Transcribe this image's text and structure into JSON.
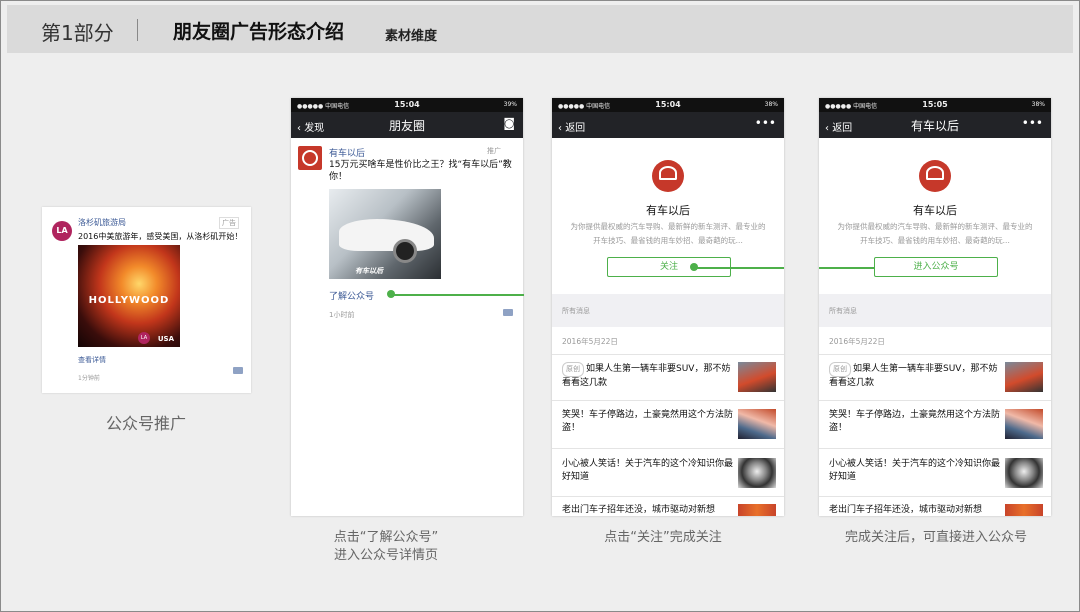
{
  "header": {
    "part": "第1部分",
    "title": "朋友圈广告形态介绍",
    "subtitle": "素材维度"
  },
  "card": {
    "avatar_text": "LA",
    "account": "洛杉矶旅游局",
    "tag": "广告",
    "text": "2016中美旅游年，感受美国，从洛杉矶开始！",
    "image_text": "HOLLYWOOD",
    "image_logo": "LA",
    "image_usa": "USA",
    "detail_link": "查看详情",
    "time": "1分钟前"
  },
  "captions": {
    "c1": "公众号推广",
    "c2_line1": "点击“了解公众号”",
    "c2_line2": "进入公众号详情页",
    "c3": "点击“关注”完成关注",
    "c4": "完成关注后，可直接进入公众号"
  },
  "phone1": {
    "carrier": "●●●●● 中国电信",
    "time": "15:04",
    "battery": "39%",
    "back": "发现",
    "title": "朋友圈",
    "account": "有车以后",
    "tag": "推广",
    "text": "15万元买啥车是性价比之王？找“有车以后”教你！",
    "image_mark": "有车以后",
    "link": "了解公众号",
    "time_ago": "1小时前"
  },
  "phone2": {
    "carrier": "●●●●● 中国电信",
    "time": "15:04",
    "battery": "38%",
    "back": "返回",
    "more": "•••",
    "account": "有车以后",
    "desc": "为你提供最权威的汽车导购、最新鲜的新车测评、最专业的开车技巧、最省钱的用车妙招、最奇葩的玩...",
    "button": "关注"
  },
  "phone3": {
    "carrier": "●●●●● 中国电信",
    "time": "15:05",
    "battery": "38%",
    "back": "返回",
    "title": "有车以后",
    "more": "•••",
    "account": "有车以后",
    "desc": "为你提供最权威的汽车导购、最新鲜的新车测评、最专业的开车技巧、最省钱的用车妙招、最奇葩的玩...",
    "button": "进入公众号"
  },
  "messages": {
    "section": "所有消息",
    "date": "2016年5月22日",
    "original": "原创",
    "m1": "如果人生第一辆车非要SUV，那不妨看看这几款",
    "m2": "笑哭！车子停路边，土豪竟然用这个方法防盗！",
    "m3": "小心被人笑话！关于汽车的这个冷知识你最好知道",
    "m4": "老出门车子招年还没，城市驱动对新想"
  },
  "colors": {
    "accent_green": "#4db04a",
    "link_blue": "#3c5a96",
    "nav_dark": "#222327",
    "brand_red": "#c6382a"
  }
}
